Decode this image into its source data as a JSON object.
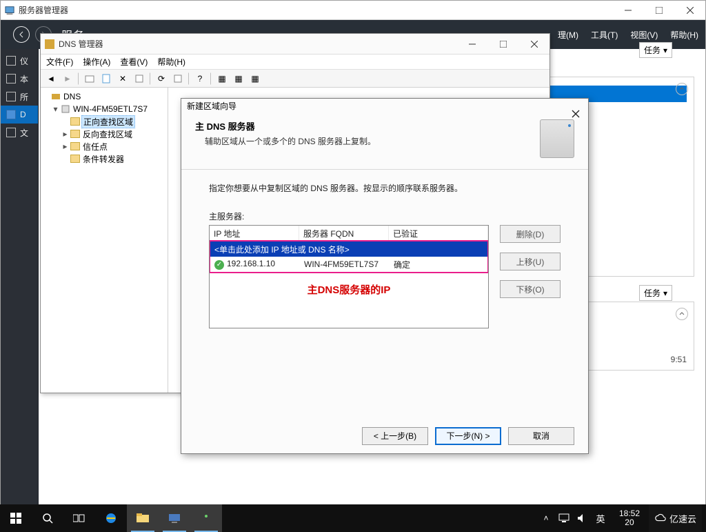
{
  "colors": {
    "accent_blue": "#0275d3",
    "pink": "#e91e8c",
    "red": "#d40000",
    "green": "#4caf50",
    "dark_header": "#282f37"
  },
  "srvmgr": {
    "title": "服务器管理器",
    "header_fragment": "服务",
    "menus": {
      "manage": "理(M)",
      "tools": "工具(T)",
      "view": "视图(V)",
      "help": "帮助(H)"
    },
    "left_items": [
      "仪",
      "本",
      "所",
      "D",
      "文"
    ],
    "left_selected": 3,
    "tasks_label": "任务",
    "timestamp_visible": "9:51"
  },
  "mmc": {
    "title": "DNS 管理器",
    "menus": {
      "file": "文件(F)",
      "action": "操作(A)",
      "view": "查看(V)",
      "help": "帮助(H)"
    },
    "tree": {
      "root": "DNS",
      "server": "WIN-4FM59ETL7S7",
      "nodes": [
        "正向查找区域",
        "反向查找区域",
        "信任点",
        "条件转发器"
      ],
      "selected": "正向查找区域"
    }
  },
  "wizard": {
    "title": "新建区域向导",
    "heading": "主 DNS 服务器",
    "subheading": "辅助区域从一个或多个的 DNS 服务器上复制。",
    "instruction": "指定你想要从中复制区域的 DNS 服务器。按显示的顺序联系服务器。",
    "list_label": "主服务器:",
    "columns": {
      "ip": "IP 地址",
      "fqdn": "服务器 FQDN",
      "validated": "已验证"
    },
    "add_placeholder": "<单击此处添加 IP 地址或 DNS 名称>",
    "rows": [
      {
        "ip": "192.168.1.10",
        "fqdn": "WIN-4FM59ETL7S7",
        "validated": "确定",
        "ok": true
      }
    ],
    "annotation": "主DNS服务器的IP",
    "buttons": {
      "delete": "删除(D)",
      "up": "上移(U)",
      "down": "下移(O)",
      "back": "< 上一步(B)",
      "next": "下一步(N)  >",
      "cancel": "取消"
    }
  },
  "taskbar": {
    "ime": "英",
    "time": "18:52",
    "date": "20",
    "brand": "亿速云"
  }
}
